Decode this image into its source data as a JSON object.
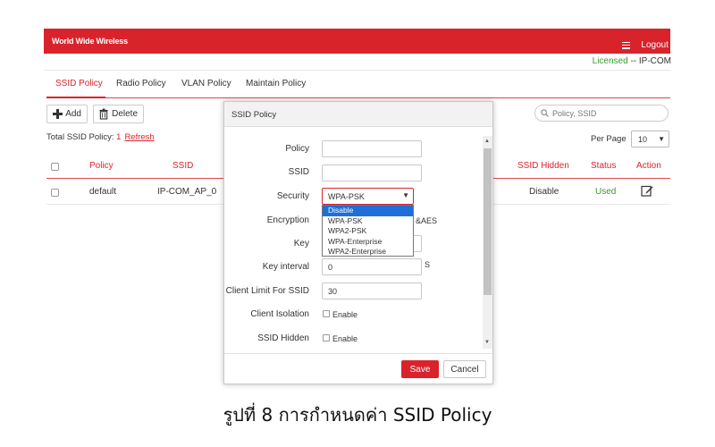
{
  "header": {
    "brand": "World Wide Wireless",
    "logout_label": "Logout",
    "license_status": "Licensed",
    "license_rest": " -- IP-COM"
  },
  "tabs": [
    {
      "label": "SSID Policy",
      "active": true
    },
    {
      "label": "Radio Policy",
      "active": false
    },
    {
      "label": "VLAN Policy",
      "active": false
    },
    {
      "label": "Maintain Policy",
      "active": false
    }
  ],
  "toolbar": {
    "add_label": "Add",
    "delete_label": "Delete",
    "search_placeholder": "Policy, SSID"
  },
  "summary": {
    "total_label": "Total SSID Policy:",
    "total_count": "1",
    "refresh_label": "Refresh",
    "per_page_label": "Per Page",
    "per_page_value": "10"
  },
  "table": {
    "headers": {
      "policy": "Policy",
      "ssid": "SSID",
      "ssid_hidden": "SSID Hidden",
      "status": "Status",
      "action": "Action"
    },
    "rows": [
      {
        "policy": "default",
        "ssid": "IP-COM_AP_0",
        "ssid_hidden": "Disable",
        "status": "Used"
      }
    ]
  },
  "modal": {
    "title": "SSID Policy",
    "fields": {
      "policy_label": "Policy",
      "policy_value": "",
      "ssid_label": "SSID",
      "ssid_value": "",
      "security_label": "Security",
      "security_value": "WPA-PSK",
      "encryption_label": "Encryption",
      "encryption_tail": "&AES",
      "key_label": "Key",
      "key_value": "",
      "key_interval_label": "Key interval",
      "key_interval_value": "0",
      "key_interval_unit": "S",
      "client_limit_label": "Client Limit For SSID",
      "client_limit_value": "30",
      "client_isolation_label": "Client Isolation",
      "client_isolation_check": "Enable",
      "ssid_hidden_label": "SSID Hidden",
      "ssid_hidden_check": "Enable"
    },
    "security_options": [
      "Disable",
      "WPA-PSK",
      "WPA2-PSK",
      "WPA-Enterprise",
      "WPA2-Enterprise"
    ],
    "security_highlighted": "Disable",
    "save_label": "Save",
    "cancel_label": "Cancel"
  },
  "caption": "รูปที่ 8 การกำหนดค่า SSID Policy",
  "colors": {
    "brand_red": "#d9232b",
    "licensed_green": "#3a9a2e",
    "dropdown_highlight": "#1e6fd9"
  },
  "icons": [
    "menu-icon",
    "plus-icon",
    "trash-icon",
    "search-icon",
    "edit-icon",
    "chevron-down-icon",
    "scroll-up-icon",
    "scroll-down-icon"
  ]
}
